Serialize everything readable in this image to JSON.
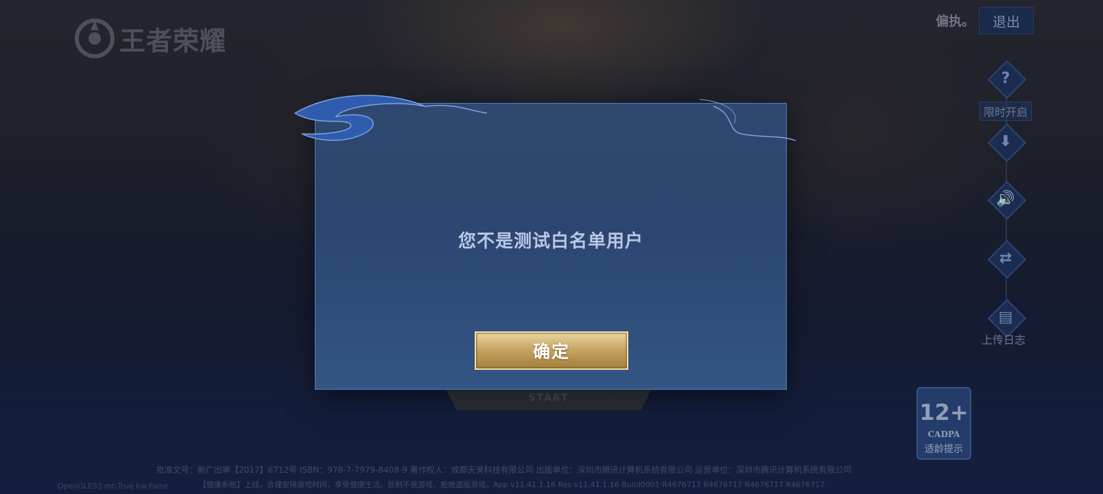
{
  "app": {
    "logo_text": "王者荣耀"
  },
  "header": {
    "username": "偏执。",
    "logout_label": "退出"
  },
  "rail": {
    "items": [
      {
        "icon": "question-icon",
        "glyph": "?",
        "label": "限时开启"
      },
      {
        "icon": "download-icon",
        "glyph": "⬇",
        "label": ""
      },
      {
        "icon": "speaker-icon",
        "glyph": "🔊",
        "label": ""
      },
      {
        "icon": "switch-account-icon",
        "glyph": "⇄",
        "label": ""
      },
      {
        "icon": "upload-log-icon",
        "glyph": "▤",
        "label": "上传日志"
      }
    ]
  },
  "start": {
    "sub_label": "START"
  },
  "age_badge": {
    "rating": "12+",
    "org": "CADPA",
    "tip": "适龄提示"
  },
  "dialog": {
    "message": "您不是测试白名单用户",
    "confirm_label": "确定"
  },
  "footer": {
    "line1": "批准文号：新广出审【2017】6712号 ISBN：978-7-7979-8408-9 著作权人：成都天美科技有限公司 出版单位：深圳市腾讯计算机系统有限公司 运营单位：深圳市腾讯计算机系统有限公司",
    "line2": "【健康系统】上线，合理安排游戏时间，享受健康生活。抵制不良游戏，拒绝盗版游戏。App v11.41.1.16 Res v11.41.1.16 Build0001 R4676717 R4676717 R4676717 R4676717",
    "gl_info": "OpenGLES3 mt:True hw:False"
  },
  "colors": {
    "dialog_bg": "#2e4870",
    "dialog_border": "#5c7fb6",
    "confirm_gold": "#c9a664"
  }
}
